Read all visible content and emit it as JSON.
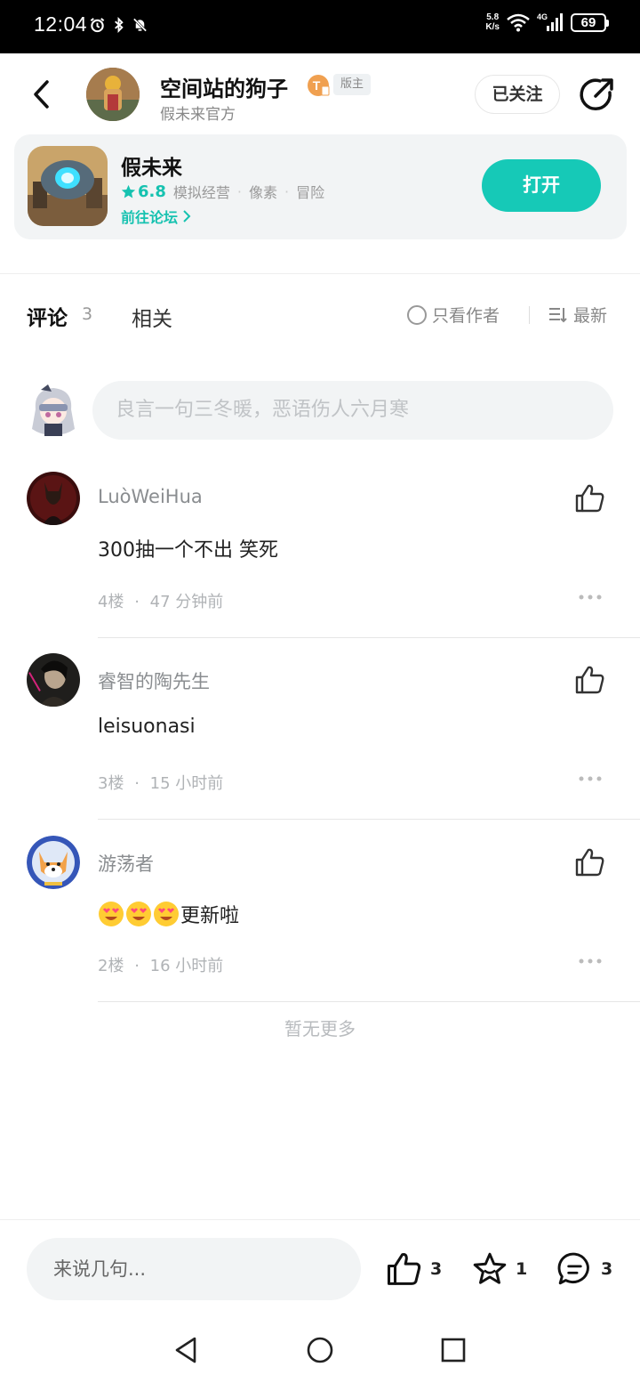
{
  "status_bar": {
    "time": "12:04",
    "net_speed_value": "5.8",
    "net_speed_unit": "K/s",
    "network_type": "4G",
    "battery": "69"
  },
  "header": {
    "author_name": "空间站的狗子",
    "level_badge_letter": "T",
    "role_badge": "版主",
    "author_subtitle": "假未来官方",
    "follow_label": "已关注"
  },
  "game_card": {
    "name": "假未来",
    "score": "6.8",
    "tags": [
      "模拟经营",
      "像素",
      "冒险"
    ],
    "tag_separator": "·",
    "forum_link": "前往论坛",
    "open_label": "打开"
  },
  "tabs": {
    "comment_label": "评论",
    "comment_count": "3",
    "related_label": "相关",
    "only_author_label": "只看作者",
    "sort_label": "最新"
  },
  "comment_input": {
    "placeholder": "良言一句三冬暖，恶语伤人六月寒"
  },
  "comments": [
    {
      "user": "LuòWeiHua",
      "text": "300抽一个不出 笑死",
      "floor": "4楼",
      "time": "47 分钟前"
    },
    {
      "user": "睿智的陶先生",
      "text": "leisuonasi",
      "floor": "3楼",
      "time": "15 小时前"
    },
    {
      "user": "游荡者",
      "text": "更新啦",
      "emoji_count": 3,
      "floor": "2楼",
      "time": "16 小时前"
    }
  ],
  "meta_separator": "·",
  "no_more_label": "暂无更多",
  "bottom_bar": {
    "input_placeholder": "来说几句...",
    "like_count": "3",
    "favorite_count": "1",
    "comment_count": "3"
  },
  "colors": {
    "accent": "#16c9b7",
    "muted_text": "#8a8d90",
    "card_bg": "#f2f4f5"
  }
}
